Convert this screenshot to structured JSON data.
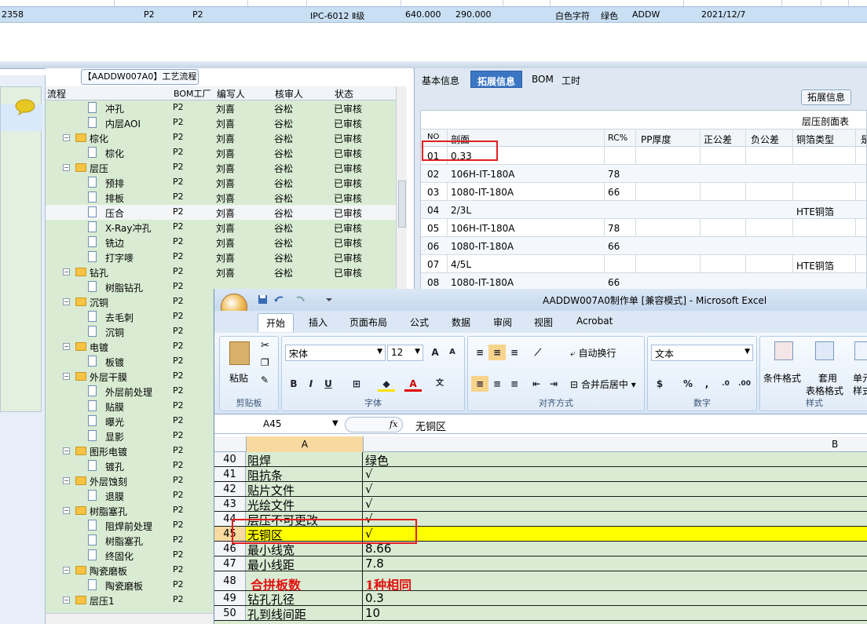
{
  "top_grid": {
    "row": [
      "2358",
      "P2",
      "P2",
      "IPC-6012 Ⅱ级",
      "640.000",
      "290.000",
      "白色字符",
      "绿色",
      "ADDW",
      "2021/12/7"
    ]
  },
  "tree_panel": {
    "title": "【AADDW007A0】工艺流程",
    "headers": [
      "流程",
      "BOM工厂",
      "编写人",
      "核审人",
      "状态"
    ],
    "rows": [
      {
        "name": "冲孔",
        "bom": "P2",
        "writer": "刘喜",
        "reviewer": "谷松",
        "status": "已审核",
        "level": 2
      },
      {
        "name": "内层AOI",
        "bom": "P2",
        "writer": "刘喜",
        "reviewer": "谷松",
        "status": "已审核",
        "level": 2
      },
      {
        "name": "棕化",
        "bom": "P2",
        "writer": "刘喜",
        "reviewer": "谷松",
        "status": "已审核",
        "level": 1
      },
      {
        "name": "棕化",
        "bom": "P2",
        "writer": "刘喜",
        "reviewer": "谷松",
        "status": "已审核",
        "level": 2
      },
      {
        "name": "层压",
        "bom": "P2",
        "writer": "刘喜",
        "reviewer": "谷松",
        "status": "已审核",
        "level": 1
      },
      {
        "name": "预排",
        "bom": "P2",
        "writer": "刘喜",
        "reviewer": "谷松",
        "status": "已审核",
        "level": 2
      },
      {
        "name": "排板",
        "bom": "P2",
        "writer": "刘喜",
        "reviewer": "谷松",
        "status": "已审核",
        "level": 2
      },
      {
        "name": "压合",
        "bom": "P2",
        "writer": "刘喜",
        "reviewer": "谷松",
        "status": "已审核",
        "level": 2,
        "selected": true
      },
      {
        "name": "X-Ray冲孔",
        "bom": "P2",
        "writer": "刘喜",
        "reviewer": "谷松",
        "status": "已审核",
        "level": 2
      },
      {
        "name": "铣边",
        "bom": "P2",
        "writer": "刘喜",
        "reviewer": "谷松",
        "status": "已审核",
        "level": 2
      },
      {
        "name": "打字嘜",
        "bom": "P2",
        "writer": "刘喜",
        "reviewer": "谷松",
        "status": "已审核",
        "level": 2
      },
      {
        "name": "钻孔",
        "bom": "P2",
        "writer": "刘喜",
        "reviewer": "谷松",
        "status": "已审核",
        "level": 1
      },
      {
        "name": "树脂钻孔",
        "bom": "P2",
        "writer": "",
        "reviewer": "",
        "status": "",
        "level": 2
      },
      {
        "name": "沉铜",
        "bom": "P2",
        "writer": "",
        "reviewer": "",
        "status": "",
        "level": 1
      },
      {
        "name": "去毛刺",
        "bom": "P2",
        "writer": "",
        "reviewer": "",
        "status": "",
        "level": 2
      },
      {
        "name": "沉铜",
        "bom": "P2",
        "writer": "",
        "reviewer": "",
        "status": "",
        "level": 2
      },
      {
        "name": "电镀",
        "bom": "P2",
        "writer": "",
        "reviewer": "",
        "status": "",
        "level": 1
      },
      {
        "name": "板镀",
        "bom": "P2",
        "writer": "",
        "reviewer": "",
        "status": "",
        "level": 2
      },
      {
        "name": "外层干膜",
        "bom": "P2",
        "writer": "",
        "reviewer": "",
        "status": "",
        "level": 1
      },
      {
        "name": "外层前处理",
        "bom": "P2",
        "writer": "",
        "reviewer": "",
        "status": "",
        "level": 2
      },
      {
        "name": "贴膜",
        "bom": "P2",
        "writer": "",
        "reviewer": "",
        "status": "",
        "level": 2
      },
      {
        "name": "曝光",
        "bom": "P2",
        "writer": "",
        "reviewer": "",
        "status": "",
        "level": 2
      },
      {
        "name": "显影",
        "bom": "P2",
        "writer": "",
        "reviewer": "",
        "status": "",
        "level": 2
      },
      {
        "name": "图形电镀",
        "bom": "P2",
        "writer": "",
        "reviewer": "",
        "status": "",
        "level": 1
      },
      {
        "name": "镀孔",
        "bom": "P2",
        "writer": "",
        "reviewer": "",
        "status": "",
        "level": 2
      },
      {
        "name": "外层蚀刻",
        "bom": "P2",
        "writer": "",
        "reviewer": "",
        "status": "",
        "level": 1
      },
      {
        "name": "退膜",
        "bom": "P2",
        "writer": "",
        "reviewer": "",
        "status": "",
        "level": 2
      },
      {
        "name": "树脂塞孔",
        "bom": "P2",
        "writer": "",
        "reviewer": "",
        "status": "",
        "level": 1
      },
      {
        "name": "阻焊前处理",
        "bom": "P2",
        "writer": "",
        "reviewer": "",
        "status": "",
        "level": 2
      },
      {
        "name": "树脂塞孔",
        "bom": "P2",
        "writer": "",
        "reviewer": "",
        "status": "",
        "level": 2
      },
      {
        "name": "终固化",
        "bom": "P2",
        "writer": "",
        "reviewer": "",
        "status": "",
        "level": 2
      },
      {
        "name": "陶瓷磨板",
        "bom": "P2",
        "writer": "",
        "reviewer": "",
        "status": "",
        "level": 1
      },
      {
        "name": "陶瓷磨板",
        "bom": "P2",
        "writer": "",
        "reviewer": "",
        "status": "",
        "level": 2
      },
      {
        "name": "层压1",
        "bom": "P2",
        "writer": "",
        "reviewer": "",
        "status": "",
        "level": 1
      }
    ]
  },
  "right_panel": {
    "tabs": [
      "基本信息",
      "拓展信息",
      "BOM",
      "工时"
    ],
    "active_tab": "拓展信息",
    "ext_button": "拓展信息",
    "caption": "层压剖面表",
    "headers": [
      "NO",
      "剖面",
      "RC%",
      "PP厚度",
      "正公差",
      "负公差",
      "铜箔类型",
      "是"
    ],
    "rows": [
      [
        "01",
        "0.33",
        "",
        "",
        "",
        "",
        "",
        ""
      ],
      [
        "02",
        "106H-IT-180A",
        "78",
        "",
        "",
        "",
        "",
        ""
      ],
      [
        "03",
        "1080-IT-180A",
        "66",
        "",
        "",
        "",
        "",
        ""
      ],
      [
        "04",
        "2/3L",
        "",
        "",
        "",
        "",
        "HTE铜箔",
        ""
      ],
      [
        "05",
        "106H-IT-180A",
        "78",
        "",
        "",
        "",
        "",
        ""
      ],
      [
        "06",
        "1080-IT-180A",
        "66",
        "",
        "",
        "",
        "",
        ""
      ],
      [
        "07",
        "4/5L",
        "",
        "",
        "",
        "",
        "HTE铜箔",
        ""
      ],
      [
        "08",
        "1080-IT-180A",
        "66",
        "",
        "",
        "",
        "",
        ""
      ]
    ]
  },
  "excel": {
    "title": "AADDW007A0制作单  [兼容模式] - Microsoft Excel",
    "tabs": [
      "开始",
      "插入",
      "页面布局",
      "公式",
      "数据",
      "审阅",
      "视图",
      "Acrobat"
    ],
    "ribbon": {
      "paste": "粘贴",
      "clipboard": "剪贴板",
      "font_name": "宋体",
      "font_size": "12",
      "font_group": "字体",
      "wrap_text": "自动换行",
      "merge_center": "合并后居中",
      "align_group": "对齐方式",
      "number_format": "文本",
      "number_group": "数字",
      "cond_format": "条件格式",
      "table_format": "套用",
      "table_format2": "表格格式",
      "cell_style": "单元",
      "cell_style2": "样式",
      "styles_group": "样式"
    },
    "name_box": "A45",
    "fx": "fx",
    "formula_value": "无铜区",
    "col_a": "A",
    "col_b": "B",
    "rows": [
      {
        "n": "40",
        "a": "阻焊",
        "b": "绿色"
      },
      {
        "n": "41",
        "a": "阻抗条",
        "b": "√"
      },
      {
        "n": "42",
        "a": "贴片文件",
        "b": "√"
      },
      {
        "n": "43",
        "a": "光绘文件",
        "b": "√"
      },
      {
        "n": "44",
        "a": "层压不可更改",
        "b": "√"
      },
      {
        "n": "45",
        "a": "无铜区",
        "b": "√",
        "highlight": true
      },
      {
        "n": "46",
        "a": "最小线宽",
        "b": "8.66"
      },
      {
        "n": "47",
        "a": "最小线距",
        "b": "7.8"
      },
      {
        "n": "48",
        "a": "合拼板数",
        "b": "1种相同",
        "emph": true
      },
      {
        "n": "49",
        "a": "钻孔孔径",
        "b": "0.3"
      },
      {
        "n": "50",
        "a": "孔到线间距",
        "b": "10"
      }
    ]
  },
  "colors": {
    "highlight": "#ffff00",
    "red_box": "#e02020",
    "green_bg": "#d9ecd3",
    "active_tab": "#3b76c4"
  }
}
